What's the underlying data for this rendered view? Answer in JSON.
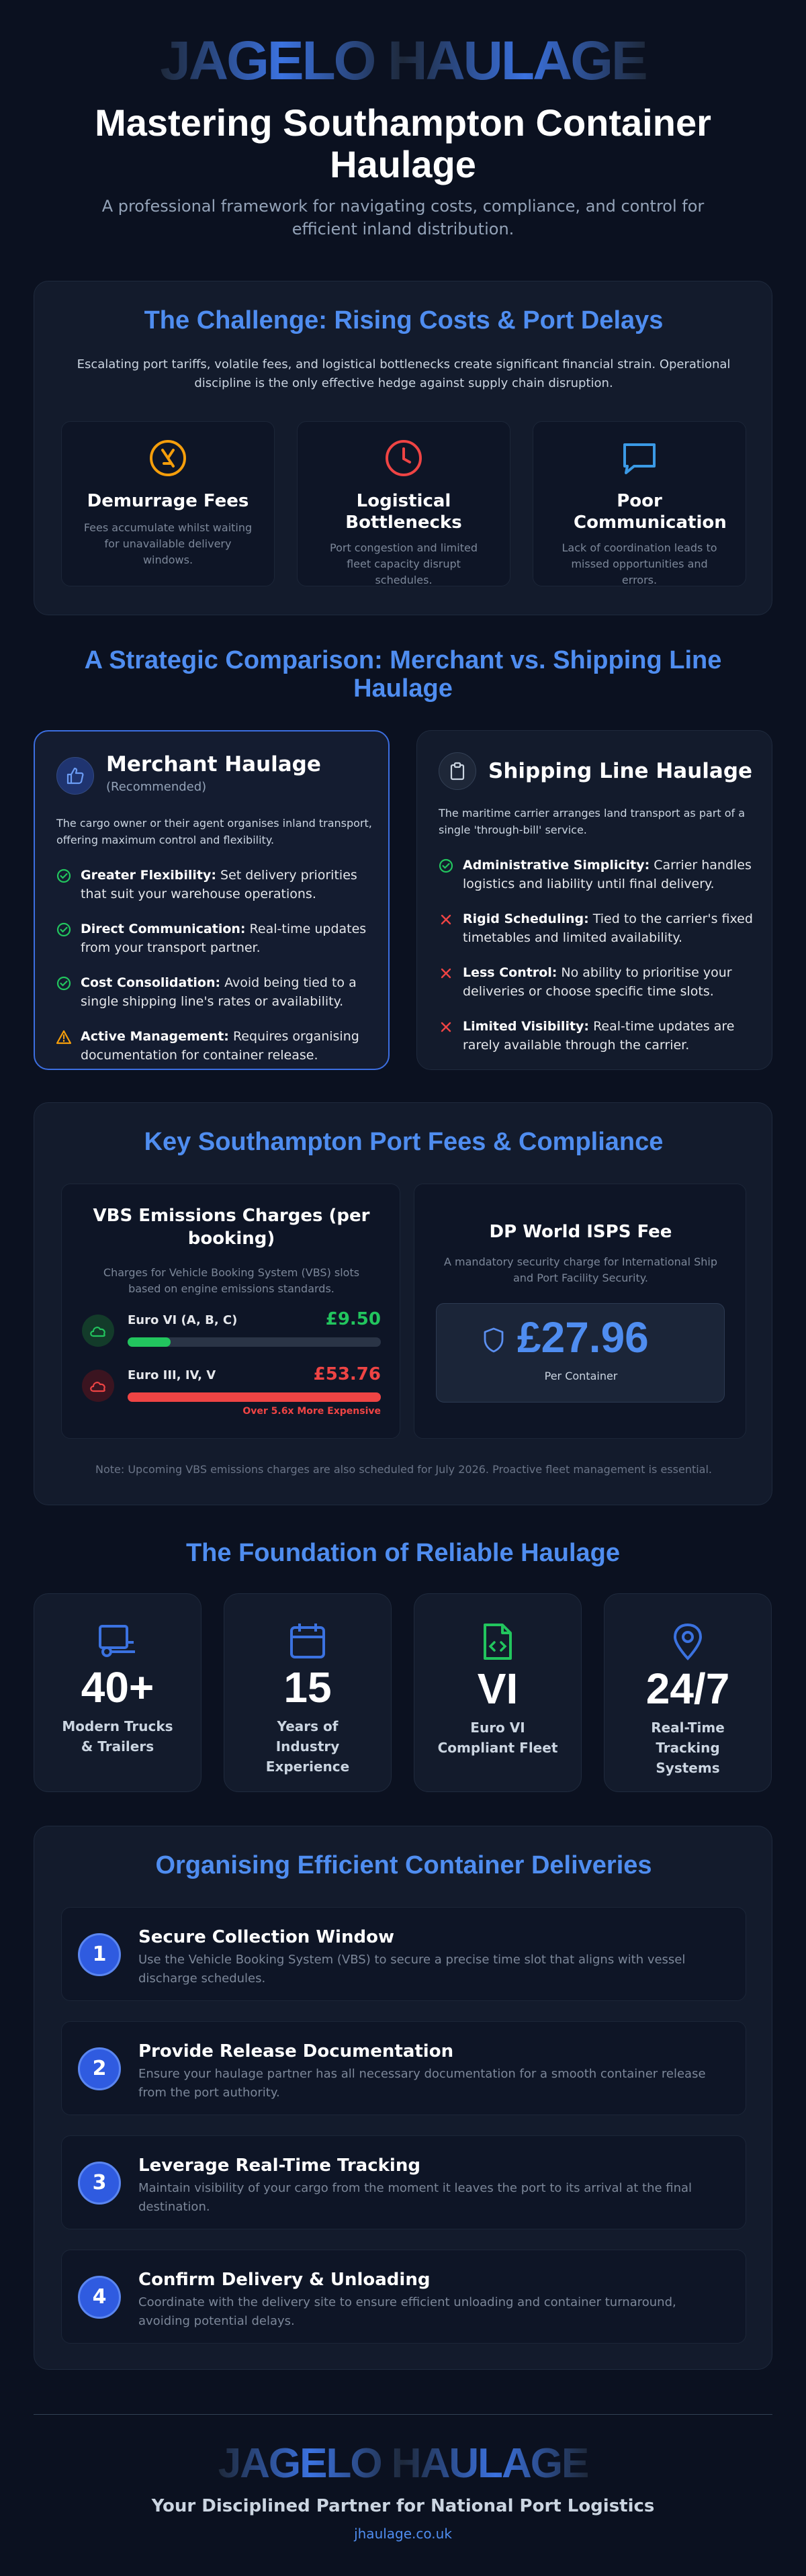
{
  "brand": {
    "logo_text": "JAGELO HAULAGE",
    "accent": "#4f8df0",
    "website": "jhaulage.co.uk"
  },
  "hero": {
    "title": "Mastering Southampton Container Haulage",
    "subtitle": "A professional framework for navigating costs, compliance, and control for efficient inland distribution."
  },
  "challenge": {
    "title": "The Challenge: Rising Costs & Port Delays",
    "body": "Escalating port tariffs, volatile fees, and logistical bottlenecks create significant financial strain. Operational discipline is the only effective hedge against supply chain disruption.",
    "items": [
      {
        "icon": "clock-cost-icon",
        "title": "Demurrage Fees",
        "desc": "Fees accumulate whilst waiting for unavailable delivery windows."
      },
      {
        "icon": "clock-icon",
        "title": "Logistical Bottlenecks",
        "desc": "Port congestion and limited fleet capacity disrupt schedules."
      },
      {
        "icon": "chat-icon",
        "title": "Poor Communication",
        "desc": "Lack of coordination leads to missed opportunities and errors."
      }
    ]
  },
  "comparison": {
    "title": "A Strategic Comparison: Merchant vs. Shipping Line Haulage",
    "merchant": {
      "title": "Merchant Haulage",
      "tag": "(Recommended)",
      "desc": "The cargo owner or their agent organises inland transport, offering maximum control and flexibility.",
      "points": [
        {
          "kind": "check",
          "bold": "Greater Flexibility:",
          "text": " Set delivery priorities that suit your warehouse operations."
        },
        {
          "kind": "check",
          "bold": "Direct Communication:",
          "text": " Real-time updates from your transport partner."
        },
        {
          "kind": "check",
          "bold": "Cost Consolidation:",
          "text": " Avoid being tied to a single shipping line's rates or availability."
        },
        {
          "kind": "warn",
          "bold": "Active Management:",
          "text": " Requires organising documentation for container release."
        }
      ]
    },
    "shipping": {
      "title": "Shipping Line Haulage",
      "desc": "The maritime carrier arranges land transport as part of a single 'through-bill' service.",
      "points": [
        {
          "kind": "check",
          "bold": "Administrative Simplicity:",
          "text": " Carrier handles logistics and liability until final delivery."
        },
        {
          "kind": "cross",
          "bold": "Rigid Scheduling:",
          "text": " Tied to the carrier's fixed timetables and limited availability."
        },
        {
          "kind": "cross",
          "bold": "Less Control:",
          "text": " No ability to prioritise your deliveries or choose specific time slots."
        },
        {
          "kind": "cross",
          "bold": "Limited Visibility:",
          "text": " Real-time updates are rarely available through the carrier."
        }
      ]
    }
  },
  "fees": {
    "title": "Key Southampton Port Fees & Compliance",
    "vbs": {
      "title": "VBS Emissions Charges (per booking)",
      "desc": "Charges for Vehicle Booking System (VBS) slots based on engine emissions standards.",
      "rows": [
        {
          "label": "Euro VI (A, B, C)",
          "value": "£9.50",
          "fill": 0.17,
          "color": "#22c55e"
        },
        {
          "label": "Euro III, IV, V",
          "value": "£53.76",
          "fill": 1.0,
          "color": "#ef4444"
        }
      ],
      "note": "Over 5.6x More Expensive"
    },
    "isps": {
      "title": "DP World ISPS Fee",
      "desc": "A mandatory security charge for International Ship and Port Facility Security.",
      "amount": "£27.96",
      "unit": "Per Container"
    },
    "footnote": "Note: Upcoming VBS emissions charges are also scheduled for July 2026. Proactive fleet management is essential."
  },
  "foundation": {
    "title": "The Foundation of Reliable Haulage",
    "stats": [
      {
        "icon": "truck-icon",
        "value": "40+",
        "label": "Modern Trucks & Trailers"
      },
      {
        "icon": "calendar-icon",
        "value": "15",
        "label": "Years of Industry Experience"
      },
      {
        "icon": "code-file-icon",
        "value": "VI",
        "label": "Euro VI Compliant Fleet"
      },
      {
        "icon": "location-pin-icon",
        "value": "24/7",
        "label": "Real-Time Tracking Systems"
      }
    ]
  },
  "steps": {
    "title": "Organising Efficient Container Deliveries",
    "items": [
      {
        "num": "1",
        "title": "Secure Collection Window",
        "desc": "Use the Vehicle Booking System (VBS) to secure a precise time slot that aligns with vessel discharge schedules."
      },
      {
        "num": "2",
        "title": "Provide Release Documentation",
        "desc": "Ensure your haulage partner has all necessary documentation for a smooth container release from the port authority."
      },
      {
        "num": "3",
        "title": "Leverage Real-Time Tracking",
        "desc": "Maintain visibility of your cargo from the moment it leaves the port to its arrival at the final destination."
      },
      {
        "num": "4",
        "title": "Confirm Delivery & Unloading",
        "desc": "Coordinate with the delivery site to ensure efficient unloading and container turnaround, avoiding potential delays."
      }
    ]
  },
  "footer": {
    "tagline": "Your Disciplined Partner for National Port Logistics"
  }
}
